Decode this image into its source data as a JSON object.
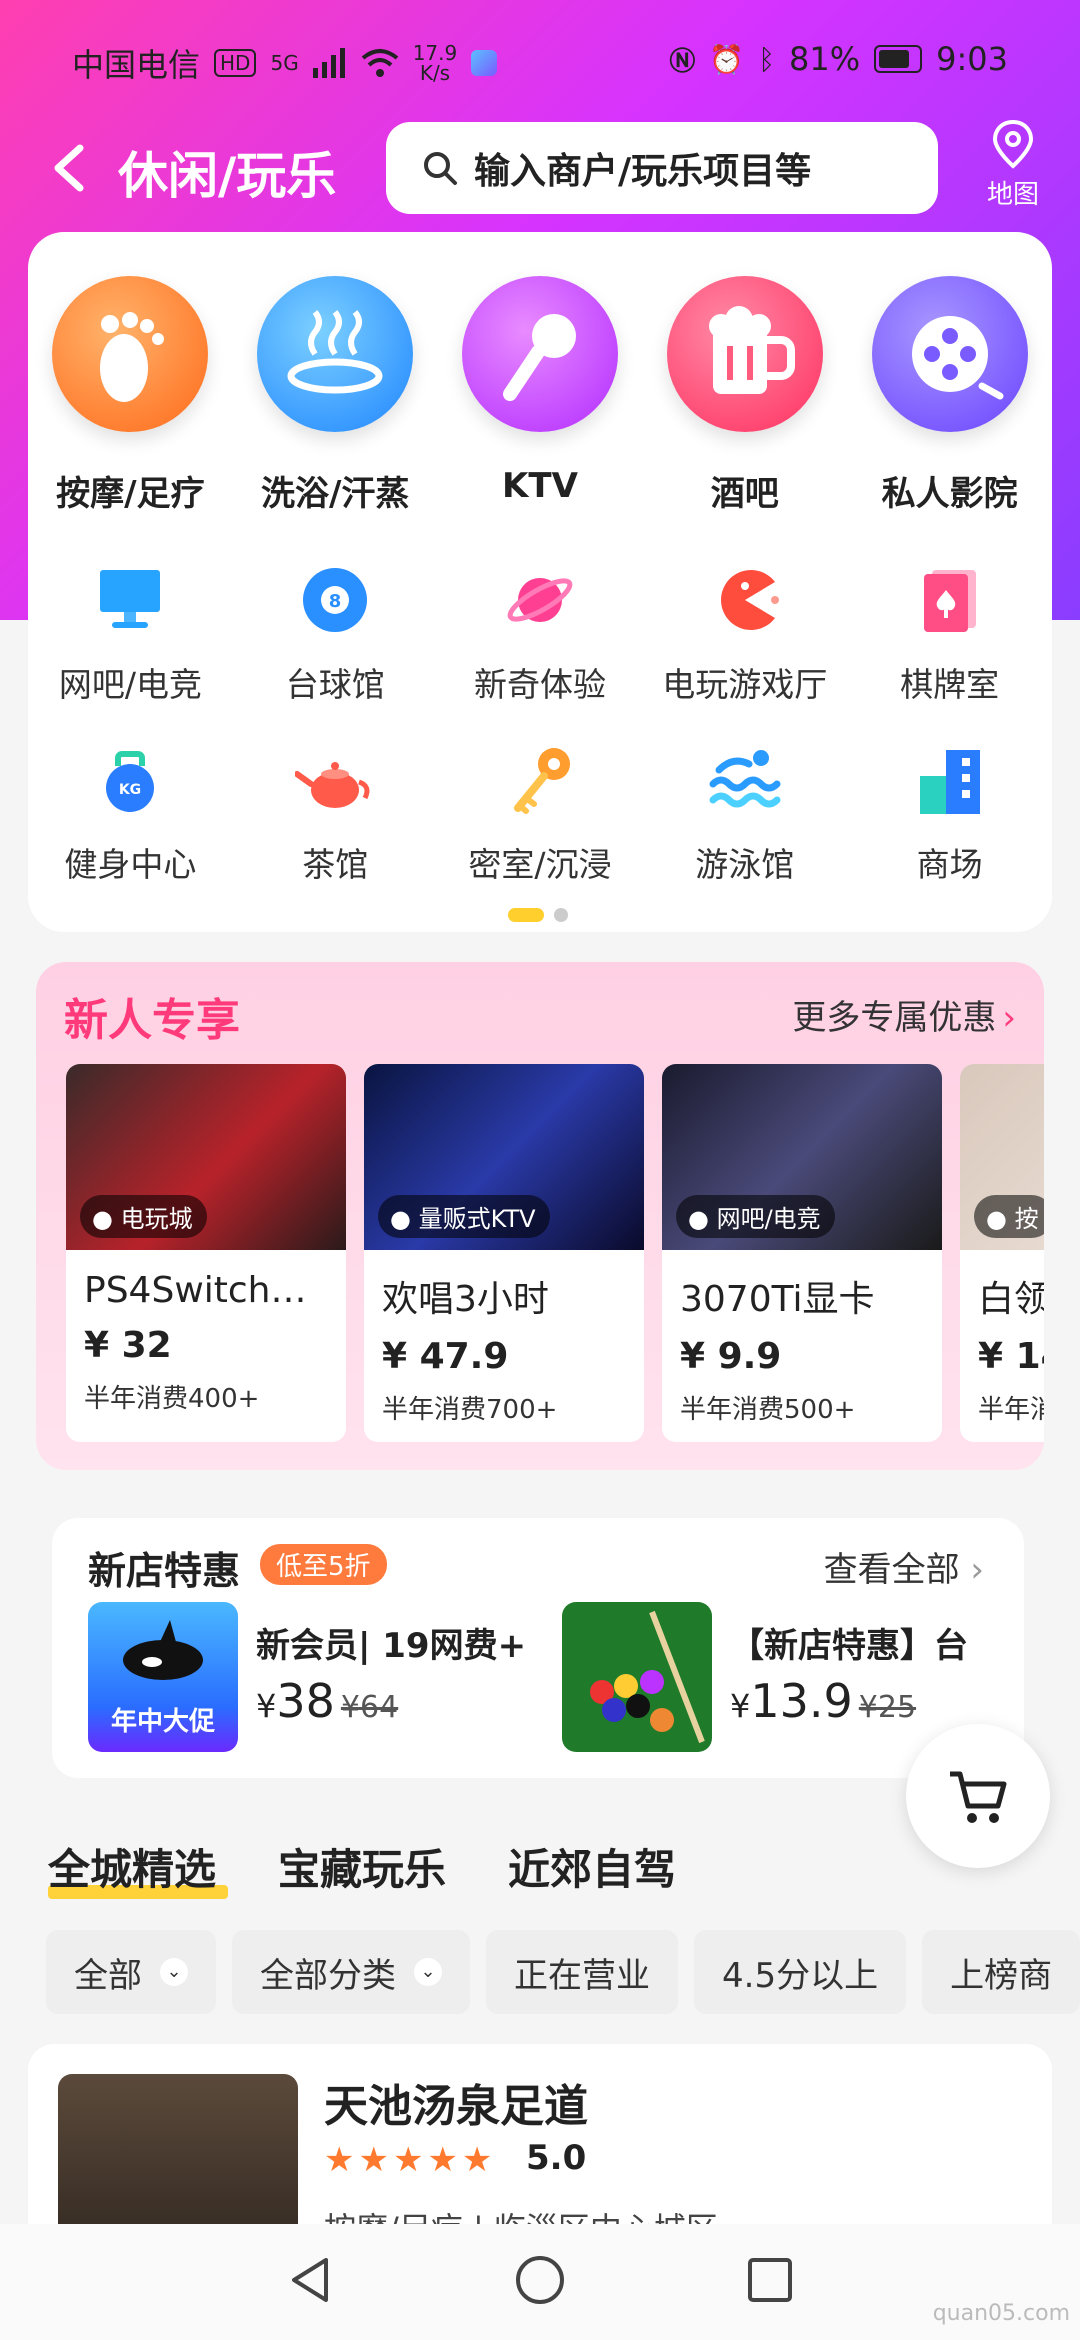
{
  "status": {
    "carrier": "中国电信",
    "hd": "HD",
    "net": "5G",
    "speed": "17.9\nK/s",
    "battery": "81%",
    "time": "9:03"
  },
  "header": {
    "title": "休闲/玩乐",
    "search_placeholder": "输入商户/玩乐项目等",
    "map_label": "地图"
  },
  "big_categories": [
    {
      "label": "按摩/足疗",
      "icon": "footprint-icon",
      "color": "#ff7a2e"
    },
    {
      "label": "洗浴/汗蒸",
      "icon": "hot-spring-icon",
      "color": "#2a9bff"
    },
    {
      "label": "KTV",
      "icon": "microphone-icon",
      "color": "#c23bff"
    },
    {
      "label": "酒吧",
      "icon": "beer-icon",
      "color": "#ff3a6b"
    },
    {
      "label": "私人影院",
      "icon": "film-reel-icon",
      "color": "#7a5bff"
    }
  ],
  "small_categories": [
    {
      "label": "网吧/电竞",
      "icon": "monitor-icon"
    },
    {
      "label": "台球馆",
      "icon": "billiard-ball-icon"
    },
    {
      "label": "新奇体验",
      "icon": "planet-icon"
    },
    {
      "label": "电玩游戏厅",
      "icon": "pacman-icon"
    },
    {
      "label": "棋牌室",
      "icon": "playing-card-icon"
    },
    {
      "label": "健身中心",
      "icon": "kettlebell-icon"
    },
    {
      "label": "茶馆",
      "icon": "teapot-icon"
    },
    {
      "label": "密室/沉浸",
      "icon": "key-icon"
    },
    {
      "label": "游泳馆",
      "icon": "swim-wave-icon"
    },
    {
      "label": "商场",
      "icon": "building-icon"
    }
  ],
  "new_user": {
    "title": "新人专享",
    "more": "更多专属优惠",
    "deals": [
      {
        "tag": "电玩城",
        "name": "PS4Switch…",
        "price": "¥ 32",
        "sold": "半年消费400+"
      },
      {
        "tag": "量贩式KTV",
        "name": "欢唱3小时",
        "price": "¥ 47.9",
        "sold": "半年消费700+"
      },
      {
        "tag": "网吧/电竞",
        "name": "3070Ti显卡",
        "price": "¥ 9.9",
        "sold": "半年消费500+"
      },
      {
        "tag": "按",
        "name": "白领",
        "price": "¥ 14",
        "sold": "半年消"
      }
    ]
  },
  "new_shop": {
    "title": "新店特惠",
    "badge": "低至5折",
    "all": "查看全部",
    "items": [
      {
        "title": "新会员| 19网费+",
        "currency": "¥",
        "price": "38",
        "orig": "¥64",
        "thumb_text": "年中大促"
      },
      {
        "title": "【新店特惠】台",
        "currency": "¥",
        "price": "13.9",
        "orig": "¥25"
      }
    ]
  },
  "tabs": [
    "全城精选",
    "宝藏玩乐",
    "近郊自驾"
  ],
  "filters": [
    {
      "label": "全部",
      "dropdown": true
    },
    {
      "label": "全部分类",
      "dropdown": true
    },
    {
      "label": "正在营业",
      "dropdown": false
    },
    {
      "label": "4.5分以上",
      "dropdown": false
    },
    {
      "label": "上榜商",
      "dropdown": false
    }
  ],
  "shop": {
    "name": "天池汤泉足道",
    "stars": "★★★★★",
    "score": "5.0",
    "sub": "按摩/足疗 | 临淄区中心城区"
  },
  "watermark": "quan05.com"
}
